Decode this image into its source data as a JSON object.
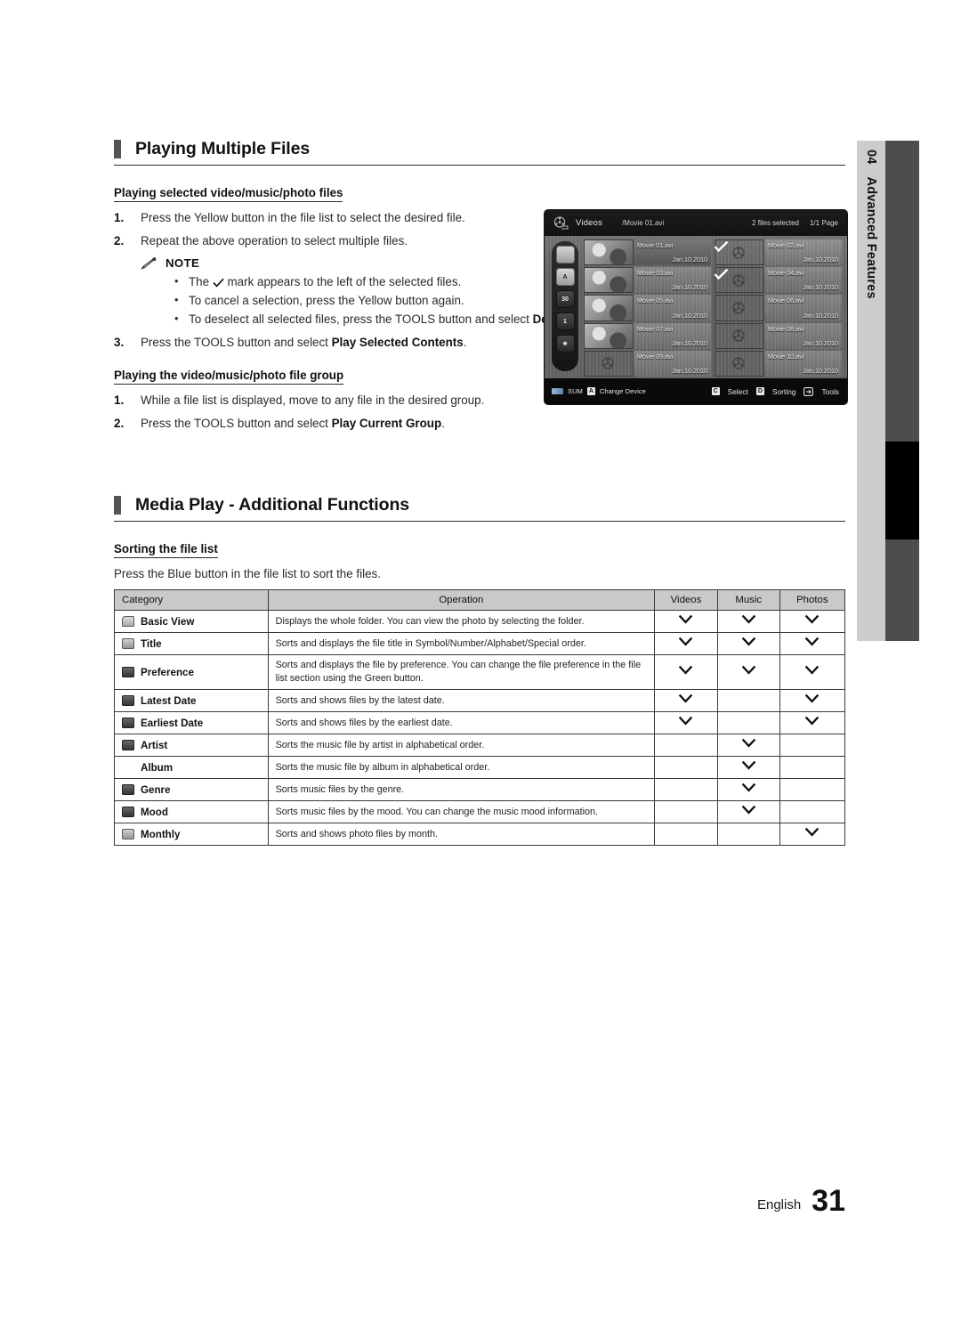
{
  "chapter": {
    "number": "04",
    "label": "Advanced Features"
  },
  "footer": {
    "language": "English",
    "page": "31"
  },
  "section1": {
    "title": "Playing Multiple Files",
    "sub1": {
      "heading": "Playing selected video/music/photo files",
      "steps": [
        {
          "num": "1.",
          "text": "Press the Yellow button in the file list to select the desired file."
        },
        {
          "num": "2.",
          "text": "Repeat the above operation to select multiple files."
        }
      ],
      "note_label": "NOTE",
      "notes": [
        {
          "pre": "The ",
          "post": " mark appears to the left of the selected files."
        },
        {
          "pre": "To cancel a selection, press the Yellow button again.",
          "post": ""
        },
        {
          "pre": "To deselect all selected files, press the TOOLS button and select ",
          "bold": "Deselect All",
          "post": "."
        }
      ],
      "step3": {
        "num": "3.",
        "pre": "Press the TOOLS button and select ",
        "bold": "Play Selected Contents",
        "post": "."
      }
    },
    "sub2": {
      "heading": "Playing the video/music/photo file group",
      "steps": [
        {
          "num": "1.",
          "pre": "While a file list is displayed, move to any file in the desired group.",
          "bold": "",
          "post": ""
        },
        {
          "num": "2.",
          "pre": "Press the TOOLS button and select ",
          "bold": "Play Current Group",
          "post": "."
        }
      ]
    }
  },
  "tv": {
    "mode": "Videos",
    "path": "/Movie 01.avi",
    "selected_count": "2 files selected",
    "page": "1/1 Page",
    "rail_icons": [
      "folder-icon",
      "title-sort-icon",
      "latest-date-icon",
      "earliest-date-icon",
      "preference-star-icon"
    ],
    "files": [
      {
        "name": "Movie 01.avi",
        "date": "Jan.10.2010",
        "thumb": "photo",
        "checked": false,
        "highlighted": true
      },
      {
        "name": "Movie 02.avi",
        "date": "Jan.10.2010",
        "thumb": "reel",
        "checked": true,
        "highlighted": false
      },
      {
        "name": "Movie 03.avi",
        "date": "Jan.10.2010",
        "thumb": "photo",
        "checked": false,
        "highlighted": false
      },
      {
        "name": "Movie 04.avi",
        "date": "Jan.10.2010",
        "thumb": "reel",
        "checked": true,
        "highlighted": false
      },
      {
        "name": "Movie 05.avi",
        "date": "Jan.10.2010",
        "thumb": "photo",
        "checked": false,
        "highlighted": false
      },
      {
        "name": "Movie 06.avi",
        "date": "Jan.10.2010",
        "thumb": "reel",
        "checked": false,
        "highlighted": false
      },
      {
        "name": "Movie 07.avi",
        "date": "Jan.10.2010",
        "thumb": "photo",
        "checked": false,
        "highlighted": false
      },
      {
        "name": "Movie 08.avi",
        "date": "Jan.10.2010",
        "thumb": "reel",
        "checked": false,
        "highlighted": false
      },
      {
        "name": "Movie 09.avi",
        "date": "Jan.10.2010",
        "thumb": "reel",
        "checked": false,
        "highlighted": false
      },
      {
        "name": "Movie 10.avi",
        "date": "Jan.10.2010",
        "thumb": "reel",
        "checked": false,
        "highlighted": false
      }
    ],
    "bottom_left": [
      {
        "key": "usb",
        "label": "SUM"
      },
      {
        "key": "A",
        "label": "Change Device"
      }
    ],
    "bottom_right": [
      {
        "key": "C",
        "label": "Select"
      },
      {
        "key": "D",
        "label": "Sorting"
      },
      {
        "key": "tools",
        "label": "Tools"
      }
    ]
  },
  "section2": {
    "title": "Media Play - Additional Functions",
    "sub1": {
      "heading": "Sorting the file list",
      "intro": "Press the Blue button in the file list to sort the files."
    },
    "table": {
      "headers": [
        "Category",
        "Operation",
        "Videos",
        "Music",
        "Photos"
      ],
      "rows": [
        {
          "icon": "folder-icon",
          "category": "Basic View",
          "operation": "Displays the whole folder. You can view the photo by selecting the folder.",
          "videos": true,
          "music": true,
          "photos": true
        },
        {
          "icon": "title-sort-icon",
          "category": "Title",
          "operation": "Sorts and displays the file title in Symbol/Number/Alphabet/Special order.",
          "videos": true,
          "music": true,
          "photos": true
        },
        {
          "icon": "preference-star-icon",
          "category": "Preference",
          "operation": "Sorts and displays the file by preference. You can change the file preference in the file list section using the Green button.",
          "videos": true,
          "music": true,
          "photos": true
        },
        {
          "icon": "latest-date-icon",
          "category": "Latest Date",
          "operation": "Sorts and shows files by the latest date.",
          "videos": true,
          "music": false,
          "photos": true
        },
        {
          "icon": "earliest-date-icon",
          "category": "Earliest Date",
          "operation": "Sorts and shows files by the earliest date.",
          "videos": true,
          "music": false,
          "photos": true
        },
        {
          "icon": "artist-icon",
          "category": "Artist",
          "operation": "Sorts the music file by artist in alphabetical order.",
          "videos": false,
          "music": true,
          "photos": false
        },
        {
          "icon": "none",
          "category": "Album",
          "operation": "Sorts the music file by album in alphabetical order.",
          "videos": false,
          "music": true,
          "photos": false
        },
        {
          "icon": "genre-icon",
          "category": "Genre",
          "operation": "Sorts music files by the genre.",
          "videos": false,
          "music": true,
          "photos": false
        },
        {
          "icon": "mood-icon",
          "category": "Mood",
          "operation": "Sorts music files by the mood. You can change the music mood information.",
          "videos": false,
          "music": true,
          "photos": false
        },
        {
          "icon": "monthly-icon",
          "category": "Monthly",
          "operation": "Sorts and shows photo files by month.",
          "videos": false,
          "music": false,
          "photos": true
        }
      ]
    }
  }
}
